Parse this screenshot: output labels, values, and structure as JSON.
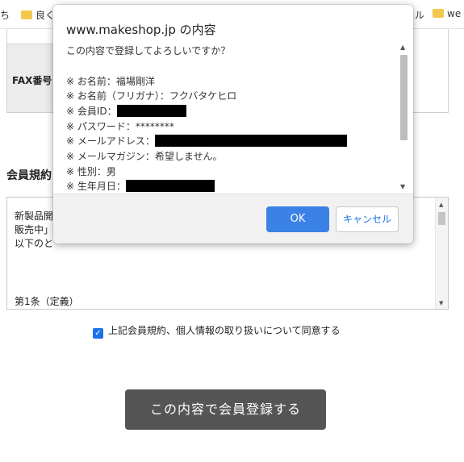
{
  "bookmarks": {
    "left_partial": "ち",
    "folder1_label": "良く",
    "right_partial": "ル",
    "folder2_label": "we"
  },
  "page": {
    "fax_label": "FAX番号",
    "section_title": "会員規約",
    "terms_lines": [
      "新製品開",
      "販売中」",
      "以下のと",
      "第1条（定義）"
    ],
    "agree_label": "上記会員規約、個人情報の取り扱いについて同意する",
    "submit_label": "この内容で会員登録する"
  },
  "dialog": {
    "title": "www.makeshop.jp の内容",
    "question": "この内容で登録してよろしいですか？",
    "rows": [
      "※ お名前：福場剛洋",
      "※ お名前（フリガナ）：フクバタケヒロ",
      "※ 会員ID：",
      "※ パスワード：********",
      "※ メールアドレス：",
      "※ メールマガジン：希望しません。",
      "※ 性別：男",
      "※ 生年月日："
    ],
    "ok_label": "OK",
    "cancel_label": "キャンセル"
  },
  "colors": {
    "ok_button": "#3b82e6",
    "submit_button": "#555555",
    "checkbox": "#1a73e8"
  }
}
